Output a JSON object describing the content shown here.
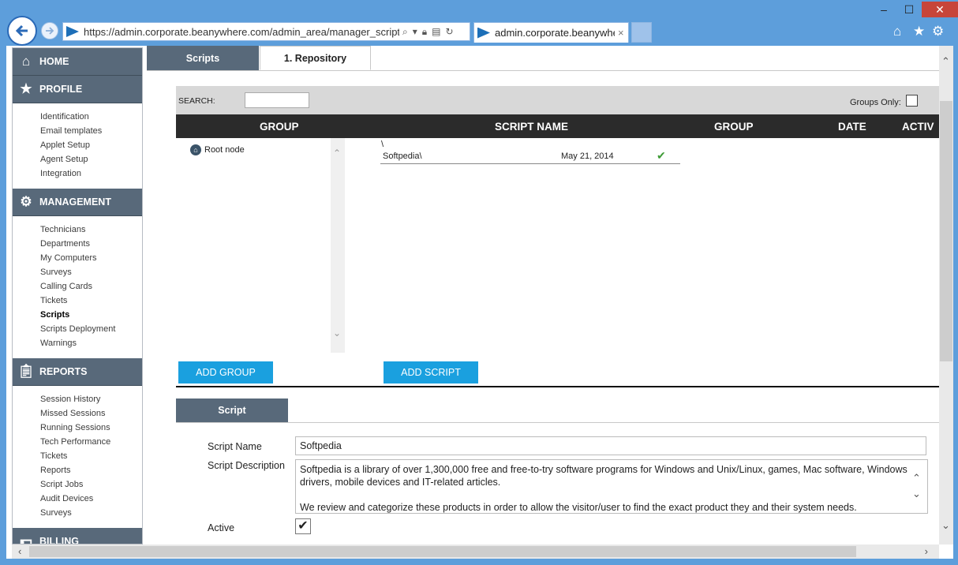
{
  "browser": {
    "url": "https://admin.corporate.beanywhere.com/admin_area/manager_scripts.php:",
    "tab_title": "admin.corporate.beanywhere...",
    "tab_close": "×",
    "window_controls": {
      "minimize": "–",
      "maximize": "☐",
      "close": "✕"
    },
    "icons": [
      "back-icon",
      "forward-icon",
      "search-icon",
      "dropdown-icon",
      "lock-icon",
      "compat-icon",
      "refresh-icon",
      "home-icon",
      "star-icon",
      "gear-icon"
    ]
  },
  "sidebar": {
    "sections": [
      {
        "title": "HOME",
        "icon": "home-icon",
        "items": []
      },
      {
        "title": "PROFILE",
        "icon": "star-icon",
        "items": [
          "Identification",
          "Email templates",
          "Applet Setup",
          "Agent Setup",
          "Integration"
        ]
      },
      {
        "title": "MANAGEMENT",
        "icon": "gear-icon",
        "items": [
          "Technicians",
          "Departments",
          "My Computers",
          "Surveys",
          "Calling Cards",
          "Tickets",
          "Scripts",
          "Scripts Deployment",
          "Warnings"
        ]
      },
      {
        "title": "REPORTS",
        "icon": "clipboard-icon",
        "items": [
          "Session History",
          "Missed Sessions",
          "Running Sessions",
          "Tech Performance",
          "Tickets",
          "Reports",
          "Script Jobs",
          "Audit Devices",
          "Surveys"
        ]
      },
      {
        "title": "BILLING",
        "icon": "billing-icon",
        "items": []
      }
    ],
    "active_item": "Scripts"
  },
  "page": {
    "tabs": [
      "Scripts",
      "1. Repository"
    ],
    "search_label": "SEARCH:",
    "search_value": "",
    "groups_only_label": "Groups Only:",
    "grid_headers": [
      "GROUP",
      "SCRIPT NAME",
      "GROUP",
      "DATE",
      "ACTIV"
    ],
    "tree": {
      "root_label": "Root node"
    },
    "path": "\\",
    "rows": [
      {
        "group": "Softpedia\\",
        "date": "May 21, 2014",
        "active": "✔"
      }
    ],
    "add_group_label": "ADD GROUP",
    "add_script_label": "ADD SCRIPT",
    "script_panel": {
      "tab": "Script",
      "name_label": "Script Name",
      "name_value": "Softpedia",
      "description_label": "Script Description",
      "description_p1": "Softpedia is a library of over 1,300,000 free and free-to-try software programs for Windows and Unix/Linux, games, Mac software, Windows drivers, mobile devices and IT-related articles.",
      "description_p2": "We review and categorize these products in order to allow the visitor/user to find the exact product they and their system needs.",
      "active_label": "Active",
      "active_check": "✔"
    }
  }
}
